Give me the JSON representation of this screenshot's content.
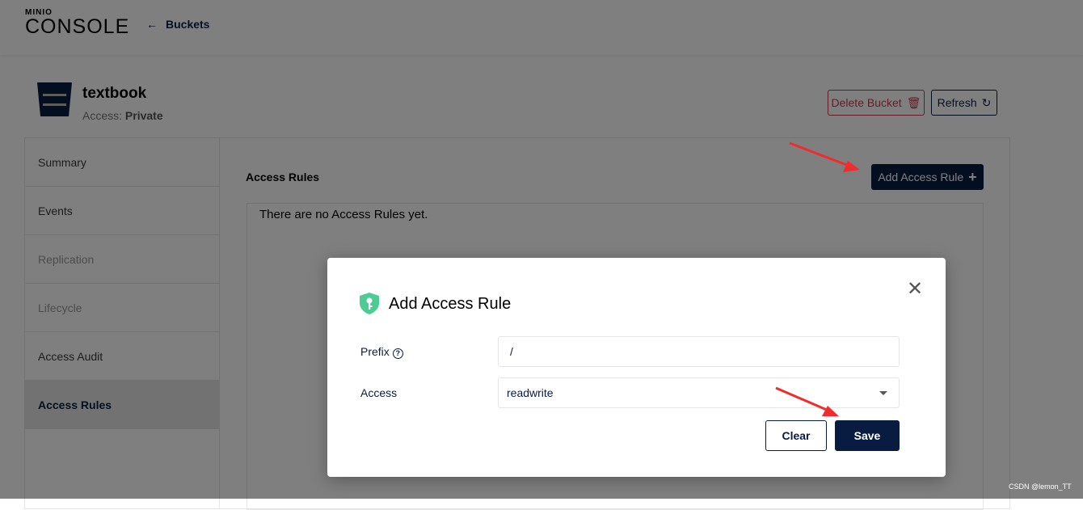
{
  "header": {
    "logo_top": "MINIO",
    "logo_bottom": "CONSOLE",
    "back_icon": "arrow-left-icon",
    "back_label": "Buckets"
  },
  "bucket": {
    "name": "textbook",
    "access_label": "Access:",
    "access_value": "Private",
    "delete_label": "Delete Bucket",
    "refresh_label": "Refresh"
  },
  "sidebar": {
    "items": [
      {
        "label": "Summary"
      },
      {
        "label": "Events"
      },
      {
        "label": "Replication"
      },
      {
        "label": "Lifecycle"
      },
      {
        "label": "Access Audit"
      },
      {
        "label": "Access Rules"
      }
    ]
  },
  "main": {
    "title": "Access Rules",
    "add_label": "Add Access Rule",
    "empty": "There are no Access Rules yet."
  },
  "modal": {
    "title": "Add Access Rule",
    "prefix_label": "Prefix",
    "prefix_value": "/",
    "access_label": "Access",
    "access_value": "readwrite",
    "clear_label": "Clear",
    "save_label": "Save"
  },
  "watermark": "CSDN @lemon_TT",
  "colors": {
    "primary": "#081c42",
    "danger": "#c83b51",
    "shield": "#4ccb92",
    "annotation": "#f02c2c"
  }
}
